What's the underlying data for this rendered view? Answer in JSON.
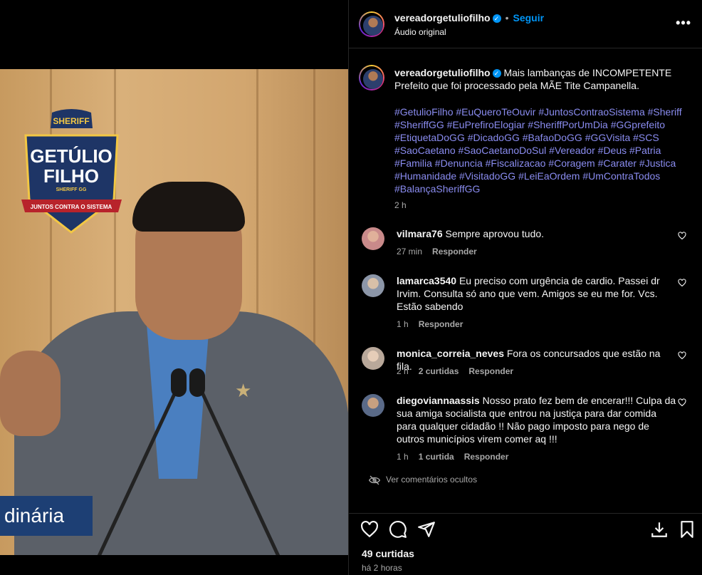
{
  "post": {
    "username": "vereadorgetuliofilho",
    "follow_label": "Seguir",
    "audio_label": "Áudio original",
    "caption_text": "Mais lambanças de INCOMPETENTE Prefeito que foi processado pela MÃE Tite Campanella.",
    "hashtags": "#GetulioFilho #EuQueroTeOuvir #JuntosContraoSistema #Sheriff #SheriffGG #EuPrefiroElogiar #SheriffPorUmDia #GGprefeito #EtiquetaDoGG #DicadoGG #BafaoDoGG #GGVisita #SCS #SaoCaetano #SaoCaetanoDoSul #Vereador #Deus #Patria #Familia #Denuncia #Fiscalizacao #Coragem #Carater #Justica #Humanidade #VisitadoGG #LeiEaOrdem #UmContraTodos #BalançaSheriffGG",
    "time_ago": "2 h",
    "likes": "49 curtidas",
    "posted_ago": "há 2 horas"
  },
  "media": {
    "badge_top": "SHERIFF",
    "badge_name_1": "GETÚLIO",
    "badge_name_2": "FILHO",
    "badge_sub": "SHERIFF GG",
    "badge_ribbon": "JUNTOS CONTRA O SISTEMA",
    "lower_third": "dinária"
  },
  "comments": [
    {
      "user": "vilmara76",
      "text": "Sempre aprovou tudo.",
      "time": "27 min",
      "likes": "",
      "reply": "Responder",
      "avatar_color": "#c98a8a"
    },
    {
      "user": "lamarca3540",
      "text": "Eu preciso com urgência de cardio. Passei dr Irvim. Consulta só ano que vem. Amigos se eu me for. Vcs. Estão sabendo",
      "time": "1 h",
      "likes": "",
      "reply": "Responder",
      "avatar_color": "#8c96a8"
    },
    {
      "user": "monica_correia_neves",
      "text": "Fora os concursados que estão na fila.",
      "time": "2 h",
      "likes": "2 curtidas",
      "reply": "Responder",
      "avatar_color": "#b9a89a"
    },
    {
      "user": "diegoviannaassis",
      "text": "Nosso prato fez bem de encerar!!! Culpa da sua amiga socialista que entrou na justiça para dar comida para qualquer cidadão !! Não pago imposto para nego de outros municípios virem comer aq !!!",
      "time": "1 h",
      "likes": "1 curtida",
      "reply": "Responder",
      "avatar_color": "#5a6a88"
    }
  ],
  "hidden_comments_label": "Ver comentários ocultos",
  "colors": {
    "accent": "#0095f6",
    "hashtag": "#8a8cf0",
    "muted": "#a8a8a8"
  },
  "icons": [
    "more-icon",
    "heart-icon",
    "comment-icon",
    "share-icon",
    "download-icon",
    "bookmark-icon",
    "hidden-eye-icon",
    "verified-icon"
  ]
}
